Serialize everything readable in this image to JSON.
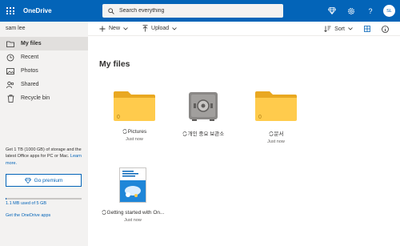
{
  "header": {
    "app_title": "OneDrive",
    "search_placeholder": "Search everything",
    "avatar_initials": "SL",
    "brand_color": "#0364b8"
  },
  "sidebar": {
    "user_name": "sam lee",
    "items": [
      {
        "label": "My files",
        "icon": "folder-icon",
        "active": true
      },
      {
        "label": "Recent",
        "icon": "clock-icon",
        "active": false
      },
      {
        "label": "Photos",
        "icon": "image-icon",
        "active": false
      },
      {
        "label": "Shared",
        "icon": "people-icon",
        "active": false
      },
      {
        "label": "Recycle bin",
        "icon": "trash-icon",
        "active": false
      }
    ],
    "promo_text": "Get 1 TB (1000 GB) of storage and the latest Office apps for PC or Mac.",
    "learn_more": "Learn more.",
    "premium_button": "Go premium",
    "storage_text": "1.1 MB used of 5 GB",
    "storage_fraction": 0.0002,
    "get_apps": "Get the OneDrive apps"
  },
  "toolbar": {
    "new_label": "New",
    "upload_label": "Upload",
    "sort_label": "Sort"
  },
  "main": {
    "title": "My files",
    "items": [
      {
        "name": "Pictures",
        "date": "Just now",
        "kind": "folder",
        "badge": "0"
      },
      {
        "name": "개인 중요 보관소",
        "date": "",
        "kind": "vault"
      },
      {
        "name": "문서",
        "date": "Just now",
        "kind": "folder",
        "badge": "0"
      },
      {
        "name": "Getting started with On...",
        "date": "Just now",
        "kind": "document"
      }
    ]
  }
}
